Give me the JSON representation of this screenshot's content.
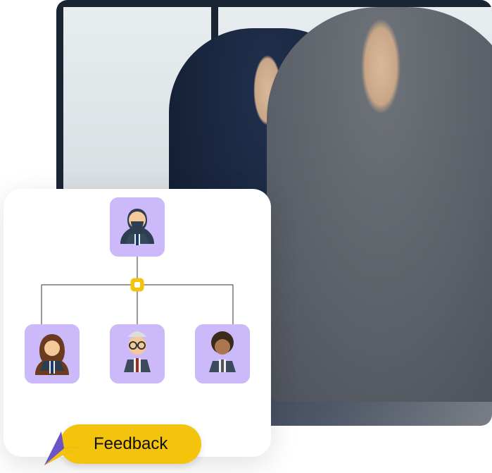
{
  "card": {
    "feedback_label": "Feedback"
  },
  "org_chart": {
    "root": {
      "icon": "person-beard"
    },
    "children": [
      {
        "icon": "person-woman"
      },
      {
        "icon": "person-glasses"
      },
      {
        "icon": "person-curly"
      }
    ]
  },
  "colors": {
    "accent_yellow": "#f4c30b",
    "avatar_bg": "#cbb9fa",
    "cursor_purple": "#6a54c8"
  }
}
